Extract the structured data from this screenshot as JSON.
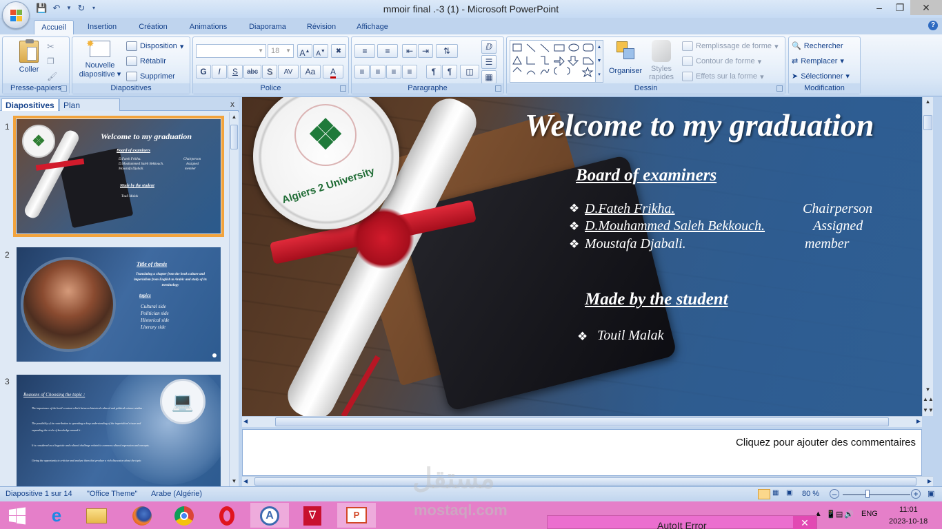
{
  "window": {
    "title": "mmoir final .-3 (1) - Microsoft PowerPoint"
  },
  "ribbon_tabs": [
    "Accueil",
    "Insertion",
    "Création",
    "Animations",
    "Diaporama",
    "Révision",
    "Affichage"
  ],
  "groups": {
    "clipboard": {
      "label": "Presse-papiers",
      "paste": "Coller"
    },
    "slides": {
      "label": "Diapositives",
      "new_line1": "Nouvelle",
      "new_line2": "diapositive",
      "layout": "Disposition",
      "reset": "Rétablir",
      "delete": "Supprimer"
    },
    "font": {
      "label": "Police",
      "size": "18",
      "bold": "G",
      "italic": "I",
      "underline": "S",
      "strike": "abc",
      "shadow": "S",
      "spacing": "AV",
      "case": "Aa",
      "color": "A"
    },
    "paragraph": {
      "label": "Paragraphe"
    },
    "drawing": {
      "label": "Dessin",
      "arrange": "Organiser",
      "styles_line1": "Styles",
      "styles_line2": "rapides",
      "fill": "Remplissage de forme",
      "outline": "Contour de forme",
      "effects": "Effets sur la forme"
    },
    "editing": {
      "label": "Modification",
      "find": "Rechercher",
      "replace": "Remplacer",
      "select": "Sélectionner"
    }
  },
  "left_panel": {
    "tab_slides": "Diapositives",
    "tab_outline": "Plan",
    "close": "x"
  },
  "thumbnails": [
    {
      "num": "1",
      "title": "Welcome to my graduation",
      "board": "Board of examiners",
      "lines": [
        "D.Fateh Frikha.",
        "D.Mouhammed Saleh Bekkouch.",
        "Moustafa Djabali."
      ],
      "roles": [
        "Chairperson",
        "Assigned",
        "member"
      ],
      "made": "Made by the student",
      "student": "Touil Malak",
      "logo": "Algiers 2 University"
    },
    {
      "num": "2",
      "title": "Title of thesis",
      "subtitle": "Translating a chapter from the book culture and imperialism from English to Arabic and study of its terminology",
      "topics": "topics",
      "items": [
        "Cultural side",
        "Politician side",
        "Historical side",
        "Literary side"
      ]
    },
    {
      "num": "3",
      "title": "Reasons of Choosing the topic :",
      "items": [
        "The importance of the book's content which between historical cultural and political science studies .",
        "The possibility of its contribution to spreading a deep understanding of the imperialism's issue and expanding the circle of knowledge around it .",
        "It is considered as a linguistic and cultural challenge related to common cultural expression and concepts .",
        "Giving the opportunity to criticize and analyze ideas that produce a rich discussion about the topic."
      ]
    }
  ],
  "slide": {
    "title": "Welcome to my graduation",
    "board": "Board of examiners",
    "examiners": [
      {
        "name": "D.Fateh Frikha.",
        "role": "Chairperson"
      },
      {
        "name": "D.Mouhammed Saleh Bekkouch.",
        "role": "Assigned"
      },
      {
        "name": "Moustafa Djabali.",
        "role": "member"
      }
    ],
    "made": "Made by the student",
    "student": "Touil Malak",
    "logo_text": "Algiers 2 University"
  },
  "notes_placeholder": "Cliquez pour ajouter des commentaires",
  "status": {
    "slide": "Diapositive 1 sur 14",
    "theme": "\"Office Theme\"",
    "lang": "Arabe (Algérie)",
    "zoom": "80 %"
  },
  "tray": {
    "lang": "ENG",
    "time": "11:01",
    "date": "2023-10-18"
  },
  "autoit": {
    "title": "AutoIt Error"
  },
  "watermark": {
    "arabic": "مستقل",
    "latin": "mostaql.com"
  }
}
